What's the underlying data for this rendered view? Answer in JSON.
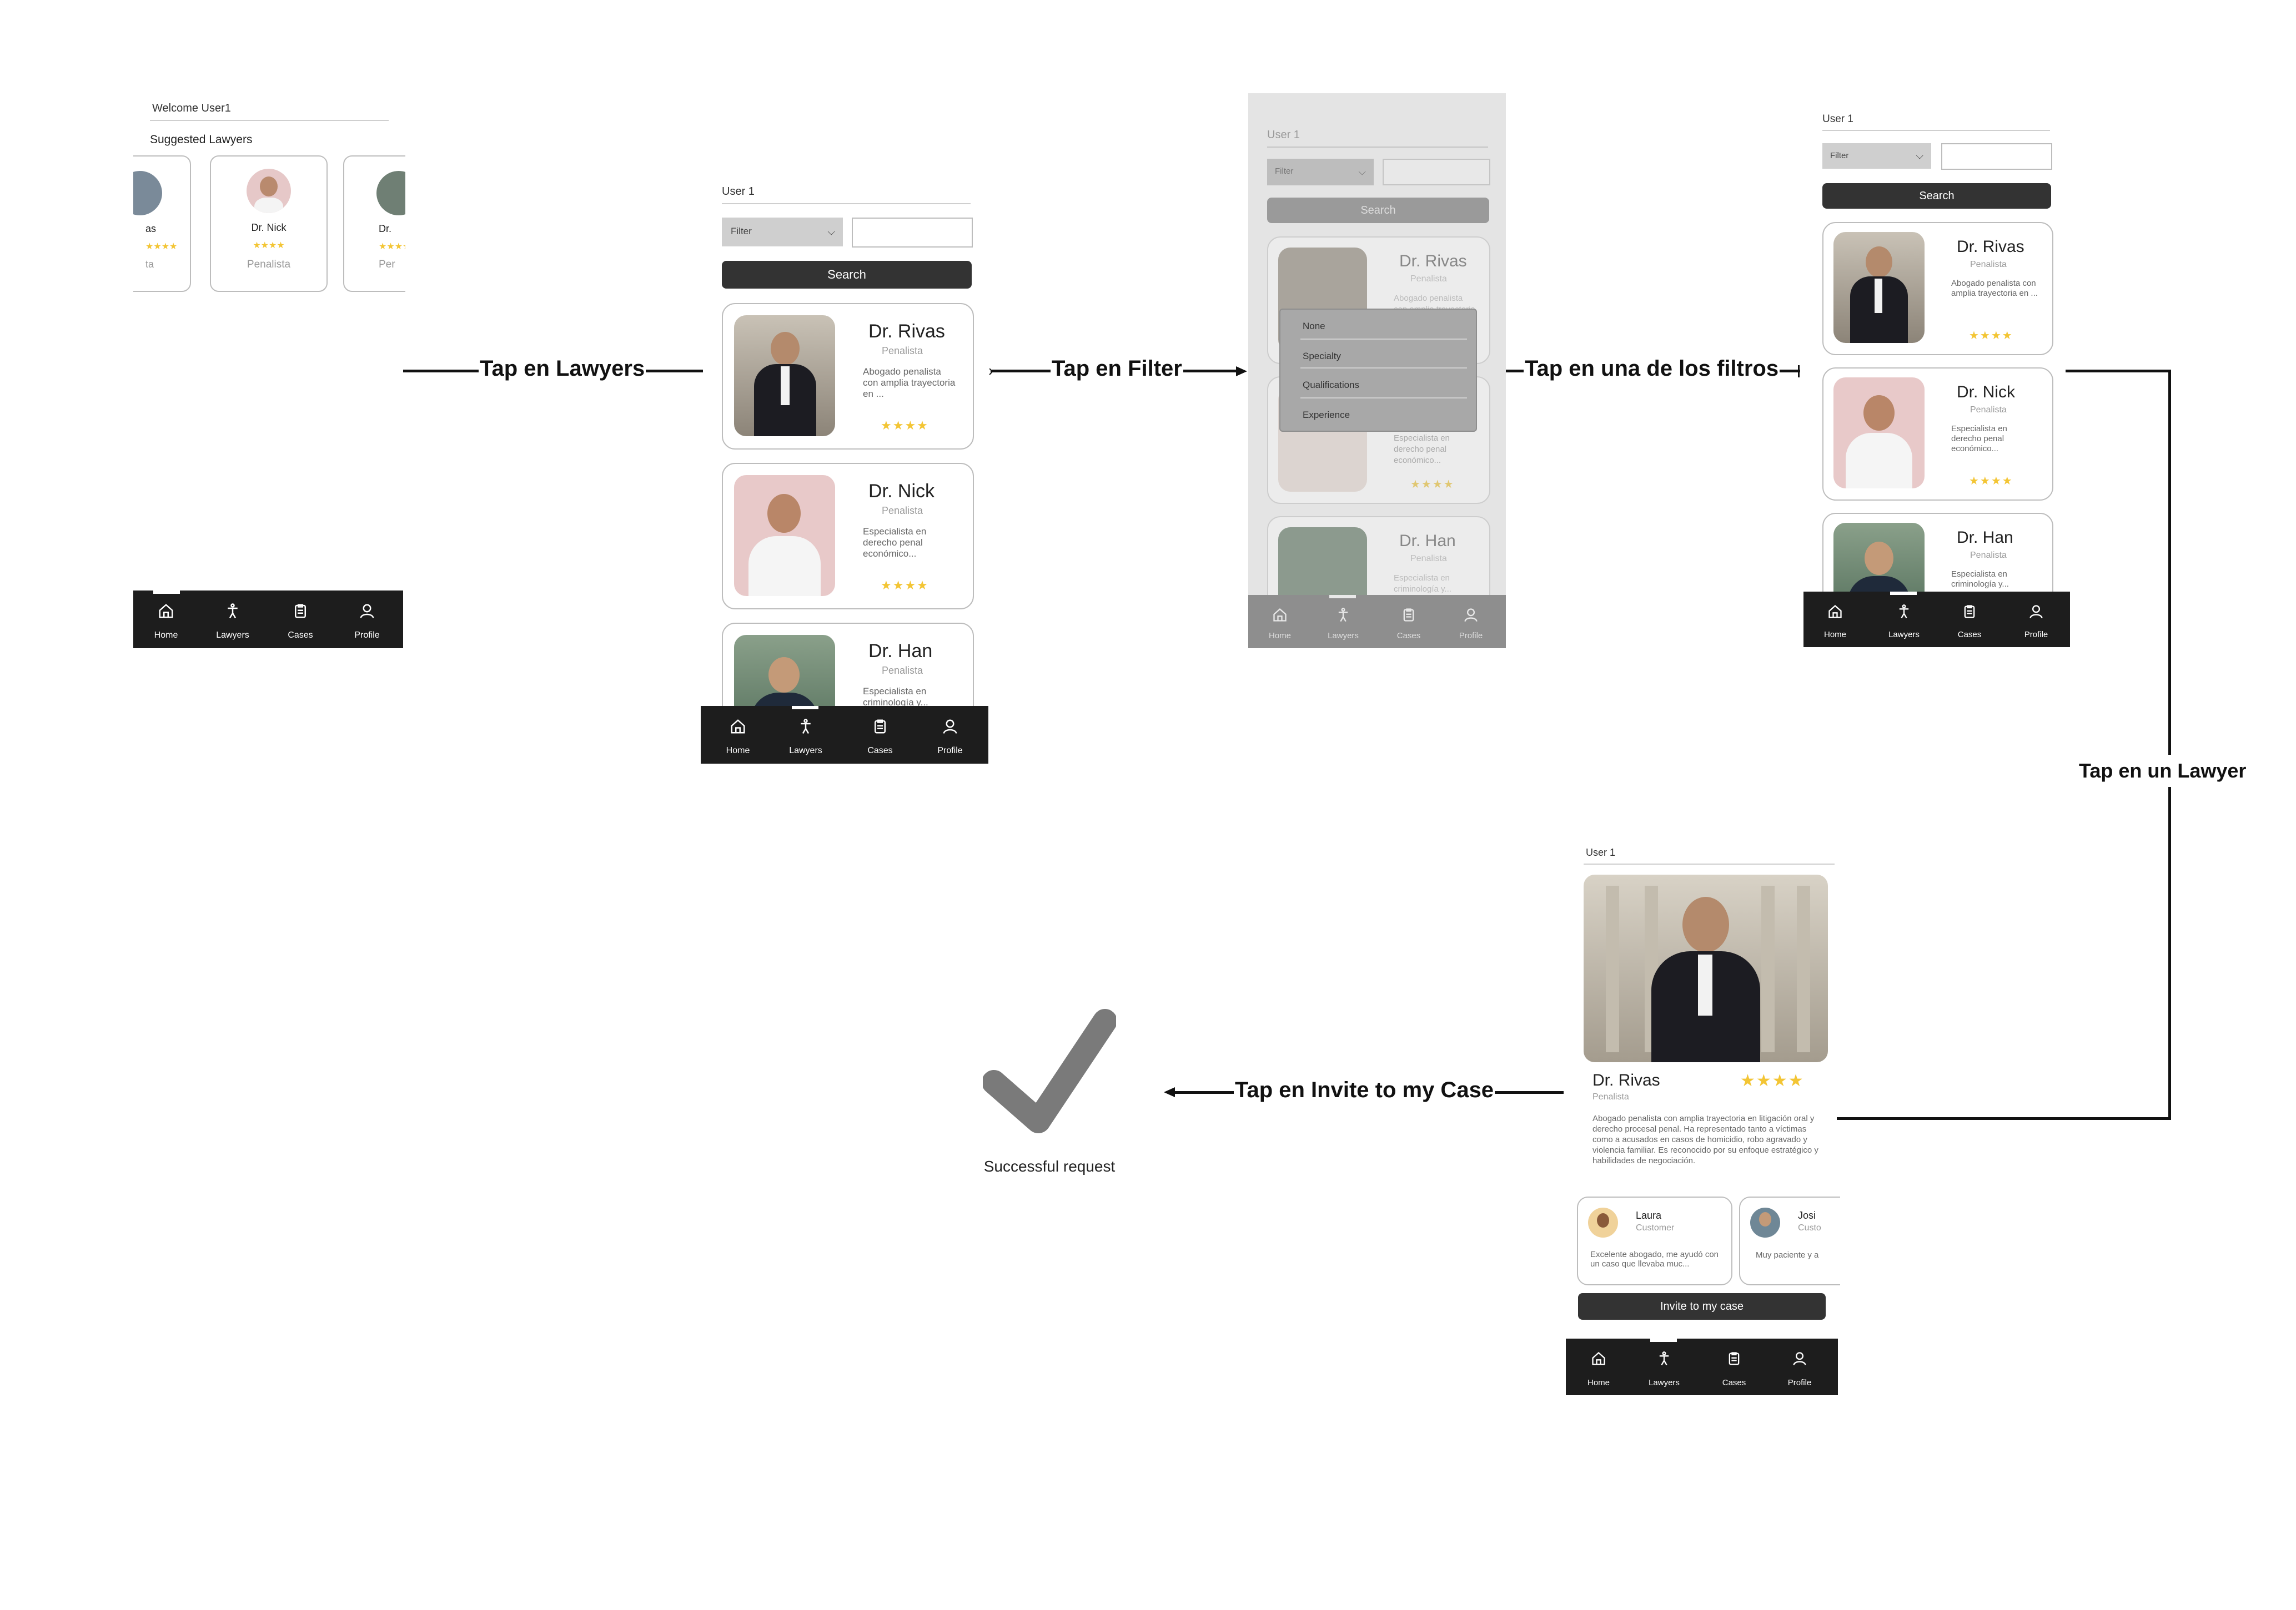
{
  "flow": {
    "tap_lawyers": "Tap en Lawyers",
    "tap_filter": "Tap en Filter",
    "tap_filtros": "Tap en una de los filtros",
    "tap_lawyer": "Tap en un Lawyer",
    "tap_invite": "Tap en Invite to my Case"
  },
  "nav": {
    "home": "Home",
    "lawyers": "Lawyers",
    "cases": "Cases",
    "profile": "Profile"
  },
  "s1": {
    "welcome": "Welcome User1",
    "suggested": "Suggested Lawyers",
    "left_name": "as",
    "left_spec": "ta",
    "mid_name": "Dr. Nick",
    "mid_spec": "Penalista",
    "right_name": "Dr.",
    "right_spec": "Per",
    "stars": "★★★★"
  },
  "list": {
    "user": "User 1",
    "filter": "Filter",
    "search": "Search",
    "lawyers": [
      {
        "name": "Dr. Rivas",
        "spec": "Penalista",
        "desc": "Abogado penalista con amplia trayectoria en ...",
        "stars": "★★★★"
      },
      {
        "name": "Dr. Nick",
        "spec": "Penalista",
        "desc": "Especialista en derecho penal económico...",
        "stars": "★★★★"
      },
      {
        "name": "Dr. Han",
        "spec": "Penalista",
        "desc": "Especialista en criminología y...",
        "stars": ""
      }
    ]
  },
  "dropdown": {
    "options": [
      "None",
      "Specialty",
      "Qualifications",
      "Experience"
    ]
  },
  "detail": {
    "user": "User 1",
    "name": "Dr. Rivas",
    "spec": "Penalista",
    "stars": "★★★★",
    "bio": "Abogado penalista con amplia trayectoria en litigación oral y derecho procesal penal. Ha representado tanto a víctimas como a acusados en casos de homicidio, robo agravado y violencia familiar. Es reconocido por su enfoque estratégico y habilidades de negociación.",
    "reviews": [
      {
        "name": "Laura",
        "role": "Customer",
        "text": "Excelente abogado, me ayudó con un caso que llevaba muc..."
      },
      {
        "name": "Josi",
        "role": "Custo",
        "text": "Muy paciente y a"
      }
    ],
    "invite": "Invite to my case"
  },
  "success": {
    "label": "Successful request"
  },
  "colors": {
    "navbar": "#1d1d1d",
    "button": "#333333",
    "star": "#f3c534",
    "check": "#7a7a7a"
  }
}
